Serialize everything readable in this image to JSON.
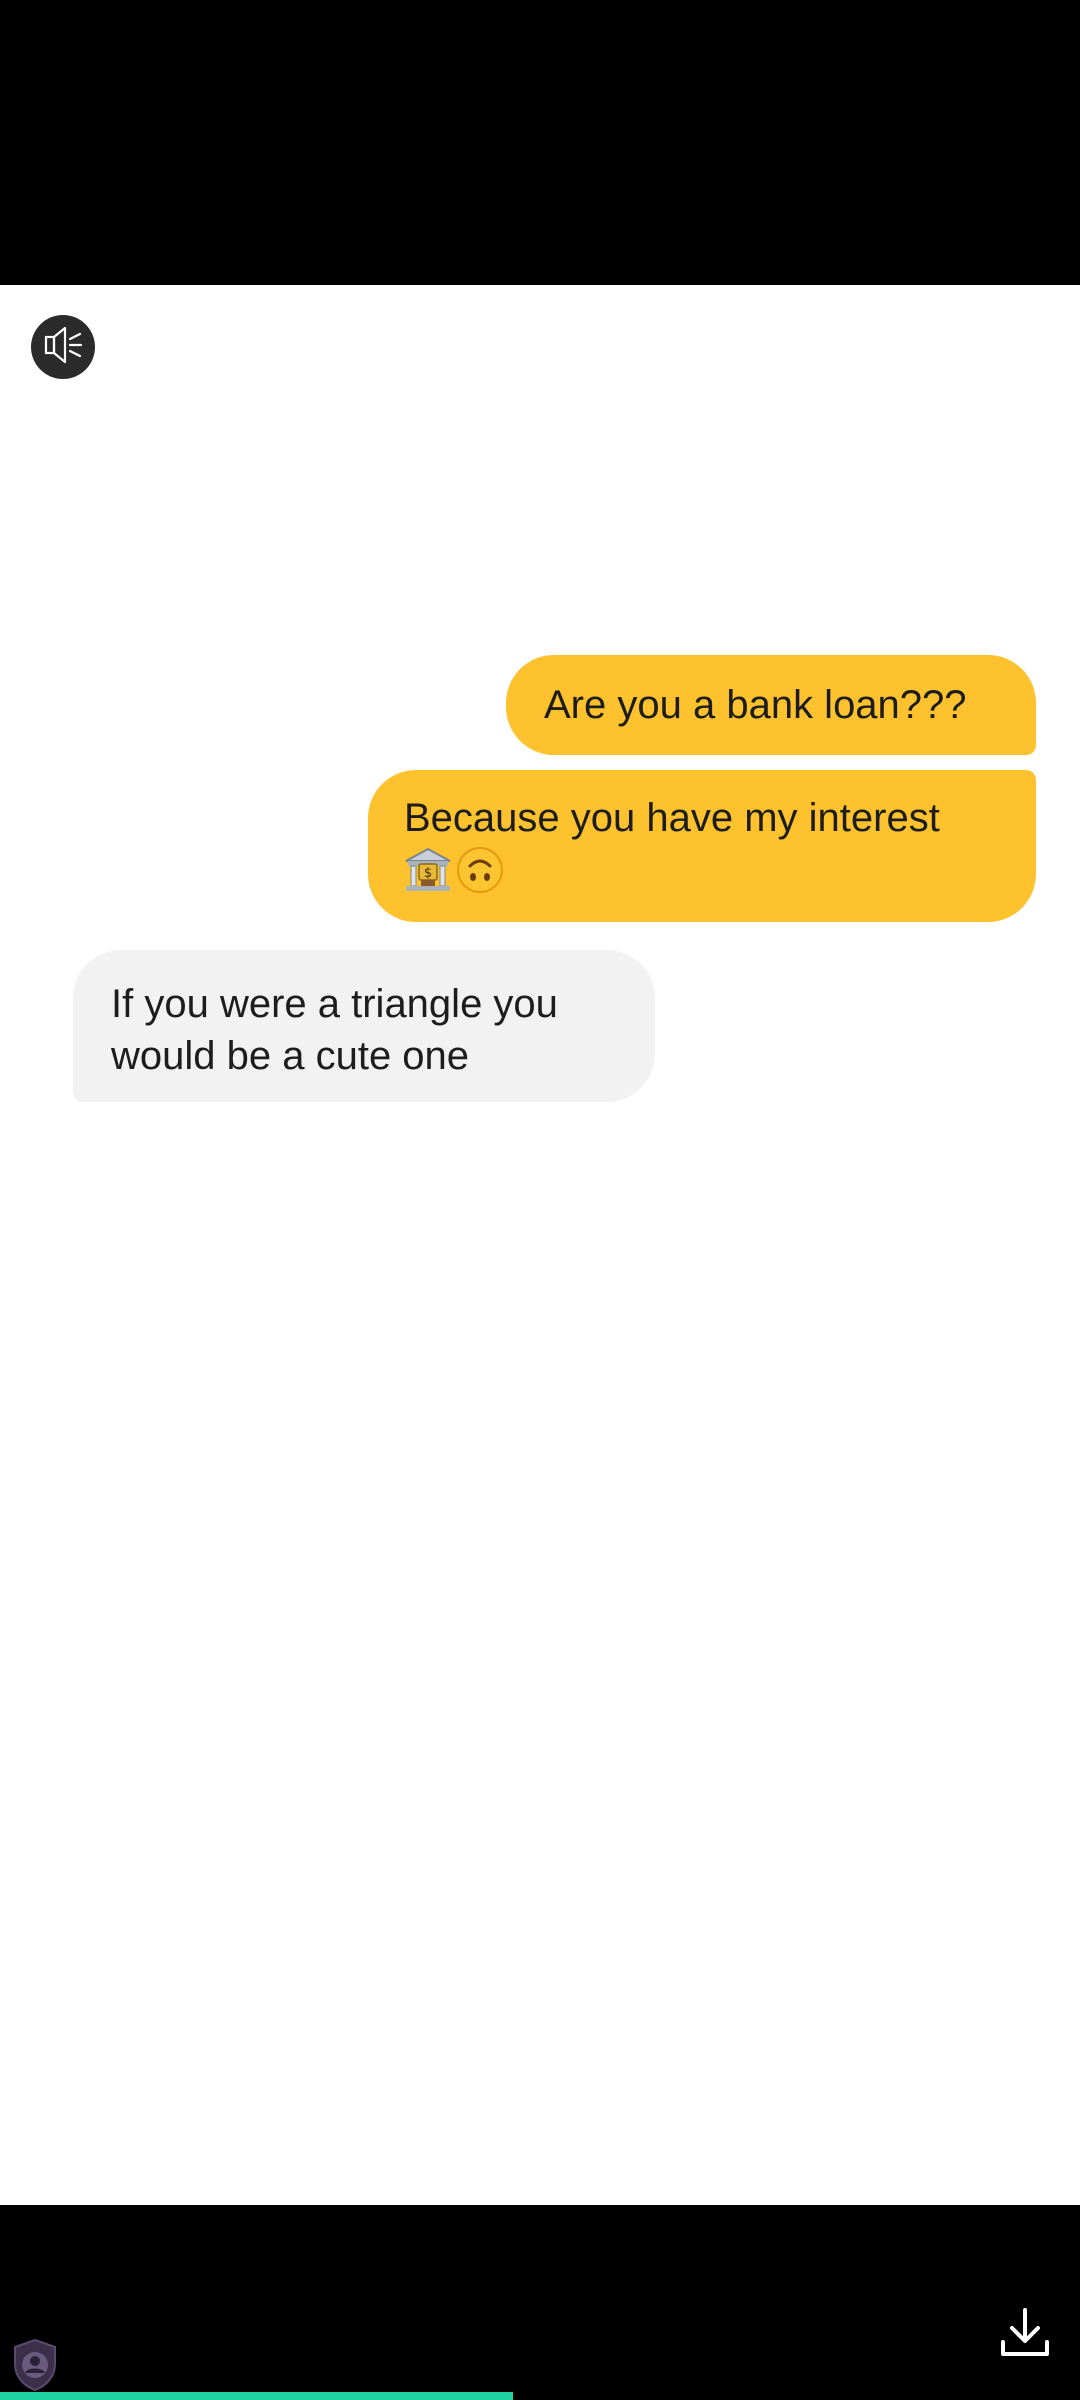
{
  "player": {
    "mute_icon": "speaker-muted-icon",
    "download_icon": "download-icon",
    "privacy_icon": "shield-user-icon",
    "progress": 0.475,
    "progress_color": "#1ed3a0"
  },
  "chat": {
    "outgoing_color": "#fdc22d",
    "incoming_color": "#f2f2f2",
    "messages": [
      {
        "direction": "outgoing",
        "text": "Are you a bank loan???"
      },
      {
        "direction": "outgoing",
        "text": "Because you have my interest",
        "emojis": [
          "bank-icon",
          "upside-down-face-icon"
        ]
      },
      {
        "direction": "incoming",
        "text": "If you were a triangle you would be a cute one"
      }
    ]
  }
}
